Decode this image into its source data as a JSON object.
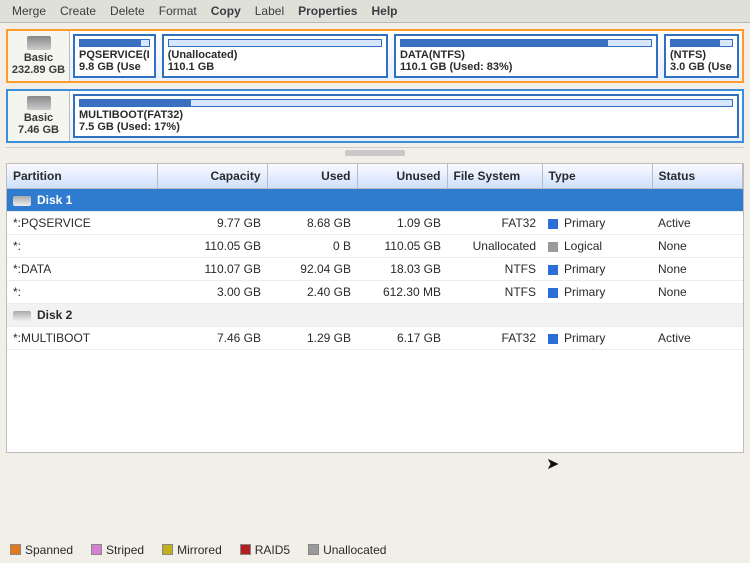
{
  "menu": {
    "items": [
      "Merge",
      "Create",
      "Delete",
      "Format",
      "Copy",
      "Label",
      "Properties",
      "Help"
    ],
    "bold_indices": [
      4,
      6,
      7
    ]
  },
  "disks_visual": [
    {
      "border": "orange",
      "label": {
        "name": "Basic",
        "size": "232.89 GB"
      },
      "parts": [
        {
          "name": "PQSERVICE(I",
          "size": "9.8 GB (Use",
          "flex": 8,
          "fill": 89
        },
        {
          "name": "(Unallocated)",
          "size": "110.1 GB",
          "flex": 34,
          "fill": 0
        },
        {
          "name": "DATA(NTFS)",
          "size": "110.1 GB (Used: 83%)",
          "flex": 40,
          "fill": 83
        },
        {
          "name": "(NTFS)",
          "size": "3.0 GB (Use",
          "flex": 10,
          "fill": 80
        }
      ]
    },
    {
      "border": "blue",
      "label": {
        "name": "Basic",
        "size": "7.46 GB"
      },
      "parts": [
        {
          "name": "MULTIBOOT(FAT32)",
          "size": "7.5 GB (Used: 17%)",
          "flex": 100,
          "fill": 17
        }
      ]
    }
  ],
  "table": {
    "headers": [
      "Partition",
      "Capacity",
      "Used",
      "Unused",
      "File System",
      "Type",
      "Status"
    ],
    "groups": [
      {
        "title": "Disk 1",
        "rows": [
          {
            "name": "*:PQSERVICE",
            "cap": "9.77 GB",
            "used": "8.68 GB",
            "unused": "1.09 GB",
            "fs": "FAT32",
            "type": "Primary",
            "type_sw": "primary",
            "status": "Active"
          },
          {
            "name": "*:",
            "cap": "110.05 GB",
            "used": "0 B",
            "unused": "110.05 GB",
            "fs": "Unallocated",
            "type": "Logical",
            "type_sw": "logical",
            "status": "None"
          },
          {
            "name": "*:DATA",
            "cap": "110.07 GB",
            "used": "92.04 GB",
            "unused": "18.03 GB",
            "fs": "NTFS",
            "type": "Primary",
            "type_sw": "primary",
            "status": "None"
          },
          {
            "name": "*:",
            "cap": "3.00 GB",
            "used": "2.40 GB",
            "unused": "612.30 MB",
            "fs": "NTFS",
            "type": "Primary",
            "type_sw": "primary",
            "status": "None"
          }
        ]
      },
      {
        "title": "Disk 2",
        "rows": [
          {
            "name": "*:MULTIBOOT",
            "cap": "7.46 GB",
            "used": "1.29 GB",
            "unused": "6.17 GB",
            "fs": "FAT32",
            "type": "Primary",
            "type_sw": "primary",
            "status": "Active"
          }
        ]
      }
    ]
  },
  "legend": [
    {
      "label": "Spanned",
      "color": "#e07a1a"
    },
    {
      "label": "Striped",
      "color": "#d77fd0"
    },
    {
      "label": "Mirrored",
      "color": "#c0b020"
    },
    {
      "label": "RAID5",
      "color": "#b02020"
    },
    {
      "label": "Unallocated",
      "color": "#9a9a9a"
    }
  ]
}
